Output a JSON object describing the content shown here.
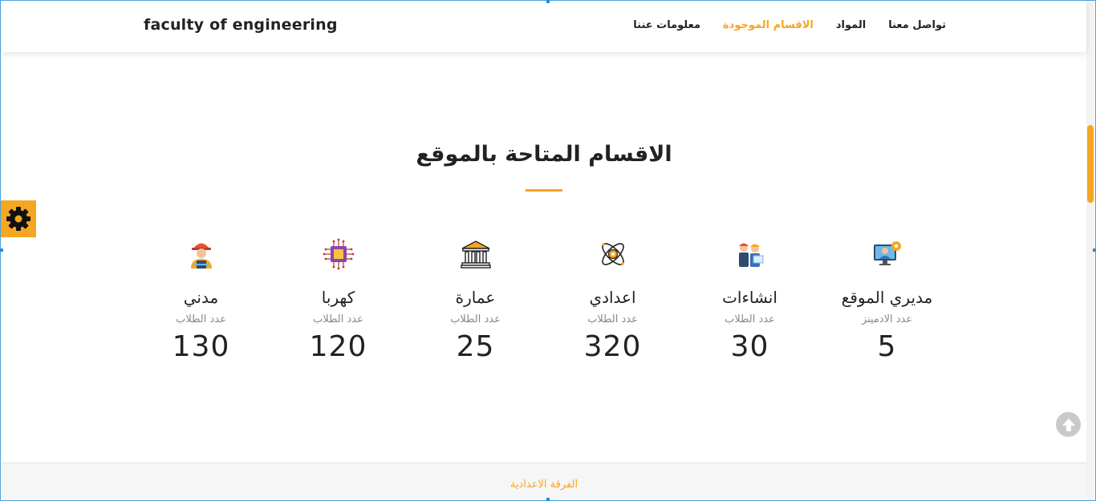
{
  "brand": "faculty of engineering",
  "nav": [
    {
      "label": "تواصل معنا",
      "active": false
    },
    {
      "label": "المواد",
      "active": false
    },
    {
      "label": "الاقسام الموجودة",
      "active": true
    },
    {
      "label": "معلومات عننا",
      "active": false
    }
  ],
  "section": {
    "title": "الاقسام المتاحة بالموقع"
  },
  "stats": [
    {
      "icon": "admin-monitor-icon",
      "name": "مديري الموقع",
      "sub": "عدد الادمينز",
      "value": "5"
    },
    {
      "icon": "construction-team-icon",
      "name": "انشاءات",
      "sub": "عدد الطلاب",
      "value": "30"
    },
    {
      "icon": "atom-icon",
      "name": "اعدادي",
      "sub": "عدد الطلاب",
      "value": "320"
    },
    {
      "icon": "building-icon",
      "name": "عمارة",
      "sub": "عدد الطلاب",
      "value": "25"
    },
    {
      "icon": "chip-icon",
      "name": "كهربا",
      "sub": "عدد الطلاب",
      "value": "120"
    },
    {
      "icon": "engineer-icon",
      "name": "مدني",
      "sub": "عدد الطلاب",
      "value": "130"
    }
  ],
  "footer": {
    "link": "الفرقة الاعدادية"
  },
  "colors": {
    "accent": "#f5a623",
    "text": "#222222",
    "muted": "#888888"
  }
}
